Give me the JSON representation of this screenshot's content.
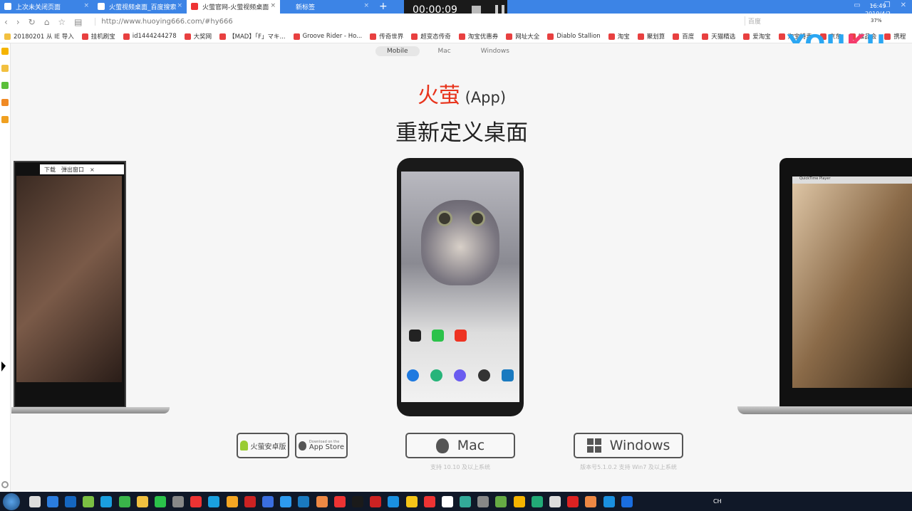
{
  "browser": {
    "tabs": [
      {
        "label": "上次未关闭页面",
        "active": false
      },
      {
        "label": "火萤视频桌面_百度搜索",
        "active": false
      },
      {
        "label": "火萤官网-火萤视频桌面",
        "active": true
      },
      {
        "label": "新标签",
        "active": false
      }
    ],
    "new_tab": "+",
    "url": "http://www.huoying666.com/#hy666",
    "search_placeholder": "百度",
    "zoom": "37%",
    "bookmarks": [
      "20180201 从 IE 导入",
      "挂机刷宝",
      "id1444244278",
      "大奖网",
      "【MAD】「F」マキ...",
      "Groove Rider - Ho...",
      "传奇世界",
      "超变态传奇",
      "淘宝优惠券",
      "网址大全",
      "Diablo Stallion",
      "淘宝",
      "聚划算",
      "百度",
      "天猫精选",
      "爱淘宝",
      "淘宝特卖",
      "京东",
      "唯品会",
      "携程"
    ]
  },
  "recorder": {
    "time": "00:00:09"
  },
  "watermark": "YOUKU",
  "page": {
    "platform_tabs": [
      "Mobile",
      "Mac",
      "Windows"
    ],
    "title_red": "火萤",
    "title_suffix": "(App)",
    "subtitle": "重新定义桌面",
    "popup": {
      "download": "下载",
      "popout": "弹出窗口",
      "close": "×"
    },
    "qt_title": "QuickTime Player",
    "buttons": {
      "android": "火萤安卓版",
      "appstore_small": "Download on the",
      "appstore": "App Store",
      "mac": "Mac",
      "windows": "Windows"
    },
    "mac_note": "支持 10.10 及以上系统",
    "windows_note": "版本号5.1.0.2   支持 Win7 及以上系统"
  },
  "taskbar": {
    "time": "16:49",
    "date": "2019/4/2",
    "ime": "CH"
  },
  "colors": {
    "tabbar": "#3c84e6",
    "accent_red": "#e8341c",
    "taskbar": "#101828"
  }
}
